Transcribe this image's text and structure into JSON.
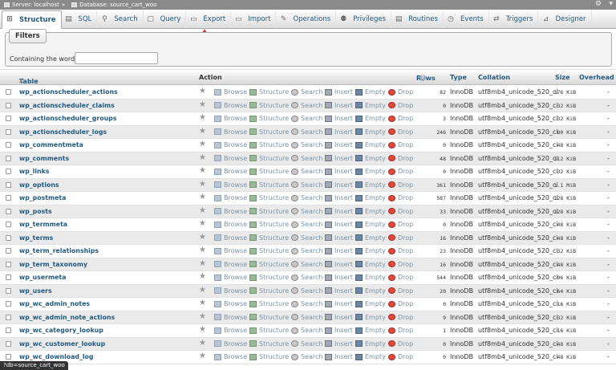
{
  "topbar": {
    "server": "Server: localhost",
    "database": "Database: source_cart_woo"
  },
  "tabs": [
    {
      "label": "Structure",
      "icon": "structure-icon",
      "glyph": "⊞",
      "active": true
    },
    {
      "label": "SQL",
      "icon": "sql-icon",
      "glyph": "▤",
      "active": false
    },
    {
      "label": "Search",
      "icon": "search-icon",
      "glyph": "⚲",
      "active": false
    },
    {
      "label": "Query",
      "icon": "query-icon",
      "glyph": "▢",
      "active": false
    },
    {
      "label": "Export",
      "icon": "export-icon",
      "glyph": "▭",
      "active": false
    },
    {
      "label": "Import",
      "icon": "import-icon",
      "glyph": "▭",
      "active": false
    },
    {
      "label": "Operations",
      "icon": "operations-icon",
      "glyph": "✎",
      "active": false
    },
    {
      "label": "Privileges",
      "icon": "privileges-icon",
      "glyph": "⚉",
      "active": false
    },
    {
      "label": "Routines",
      "icon": "routines-icon",
      "glyph": "▤",
      "active": false
    },
    {
      "label": "Events",
      "icon": "events-icon",
      "glyph": "◷",
      "active": false
    },
    {
      "label": "Triggers",
      "icon": "triggers-icon",
      "glyph": "⇄",
      "active": false
    },
    {
      "label": "Designer",
      "icon": "designer-icon",
      "glyph": "⊿",
      "active": false
    }
  ],
  "filters": {
    "legend": "Filters",
    "label": "Containing the word:",
    "value": ""
  },
  "table_header": {
    "table": "Table",
    "action": "Action",
    "rows": "Rows",
    "type": "Type",
    "collation": "Collation",
    "size": "Size",
    "overhead": "Overhead"
  },
  "actions": {
    "browse": "Browse",
    "structure": "Structure",
    "search": "Search",
    "insert": "Insert",
    "empty": "Empty",
    "drop": "Drop"
  },
  "rows": [
    {
      "name": "wp_actionscheduler_actions",
      "rows": "82",
      "type": "InnoDB",
      "collation": "utf8mb4_unicode_520_ci",
      "size": "176 KiB",
      "overhead": "-"
    },
    {
      "name": "wp_actionscheduler_claims",
      "rows": "0",
      "type": "InnoDB",
      "collation": "utf8mb4_unicode_520_ci",
      "size": "32 KiB",
      "overhead": "-"
    },
    {
      "name": "wp_actionscheduler_groups",
      "rows": "3",
      "type": "InnoDB",
      "collation": "utf8mb4_unicode_520_ci",
      "size": "32 KiB",
      "overhead": "-"
    },
    {
      "name": "wp_actionscheduler_logs",
      "rows": "246",
      "type": "InnoDB",
      "collation": "utf8mb4_unicode_520_ci",
      "size": "80 KiB",
      "overhead": "-"
    },
    {
      "name": "wp_commentmeta",
      "rows": "0",
      "type": "InnoDB",
      "collation": "utf8mb4_unicode_520_ci",
      "size": "48 KiB",
      "overhead": "-"
    },
    {
      "name": "wp_comments",
      "rows": "48",
      "type": "InnoDB",
      "collation": "utf8mb4_unicode_520_ci",
      "size": "112 KiB",
      "overhead": "-"
    },
    {
      "name": "wp_links",
      "rows": "0",
      "type": "InnoDB",
      "collation": "utf8mb4_unicode_520_ci",
      "size": "32 KiB",
      "overhead": "-"
    },
    {
      "name": "wp_options",
      "rows": "361",
      "type": "InnoDB",
      "collation": "utf8mb4_unicode_520_ci",
      "size": "1.1 MiB",
      "overhead": "-"
    },
    {
      "name": "wp_postmeta",
      "rows": "587",
      "type": "InnoDB",
      "collation": "utf8mb4_unicode_520_ci",
      "size": "128 KiB",
      "overhead": "-"
    },
    {
      "name": "wp_posts",
      "rows": "33",
      "type": "InnoDB",
      "collation": "utf8mb4_unicode_520_ci",
      "size": "128 KiB",
      "overhead": "-"
    },
    {
      "name": "wp_termmeta",
      "rows": "0",
      "type": "InnoDB",
      "collation": "utf8mb4_unicode_520_ci",
      "size": "48 KiB",
      "overhead": "-"
    },
    {
      "name": "wp_terms",
      "rows": "16",
      "type": "InnoDB",
      "collation": "utf8mb4_unicode_520_ci",
      "size": "48 KiB",
      "overhead": "-"
    },
    {
      "name": "wp_term_relationships",
      "rows": "23",
      "type": "InnoDB",
      "collation": "utf8mb4_unicode_520_ci",
      "size": "32 KiB",
      "overhead": "-"
    },
    {
      "name": "wp_term_taxonomy",
      "rows": "16",
      "type": "InnoDB",
      "collation": "utf8mb4_unicode_520_ci",
      "size": "48 KiB",
      "overhead": "-"
    },
    {
      "name": "wp_usermeta",
      "rows": "544",
      "type": "InnoDB",
      "collation": "utf8mb4_unicode_520_ci",
      "size": "96 KiB",
      "overhead": "-"
    },
    {
      "name": "wp_users",
      "rows": "20",
      "type": "InnoDB",
      "collation": "utf8mb4_unicode_520_ci",
      "size": "64 KiB",
      "overhead": "-"
    },
    {
      "name": "wp_wc_admin_notes",
      "rows": "0",
      "type": "InnoDB",
      "collation": "utf8mb4_unicode_520_ci",
      "size": "16 KiB",
      "overhead": "-"
    },
    {
      "name": "wp_wc_admin_note_actions",
      "rows": "9",
      "type": "InnoDB",
      "collation": "utf8mb4_unicode_520_ci",
      "size": "32 KiB",
      "overhead": "-"
    },
    {
      "name": "wp_wc_category_lookup",
      "rows": "1",
      "type": "InnoDB",
      "collation": "utf8mb4_unicode_520_ci",
      "size": "16 KiB",
      "overhead": "-"
    },
    {
      "name": "wp_wc_customer_lookup",
      "rows": "0",
      "type": "InnoDB",
      "collation": "utf8mb4_unicode_520_ci",
      "size": "48 KiB",
      "overhead": "-"
    },
    {
      "name": "wp_wc_download_log",
      "rows": "0",
      "type": "InnoDB",
      "collation": "utf8mb4_unicode_520_ci",
      "size": "48 KiB",
      "overhead": "-"
    }
  ],
  "statusbar": "?db=source_cart_woo",
  "colors": {
    "link": "#235a81",
    "annotation_arrow": "#d9342b"
  }
}
